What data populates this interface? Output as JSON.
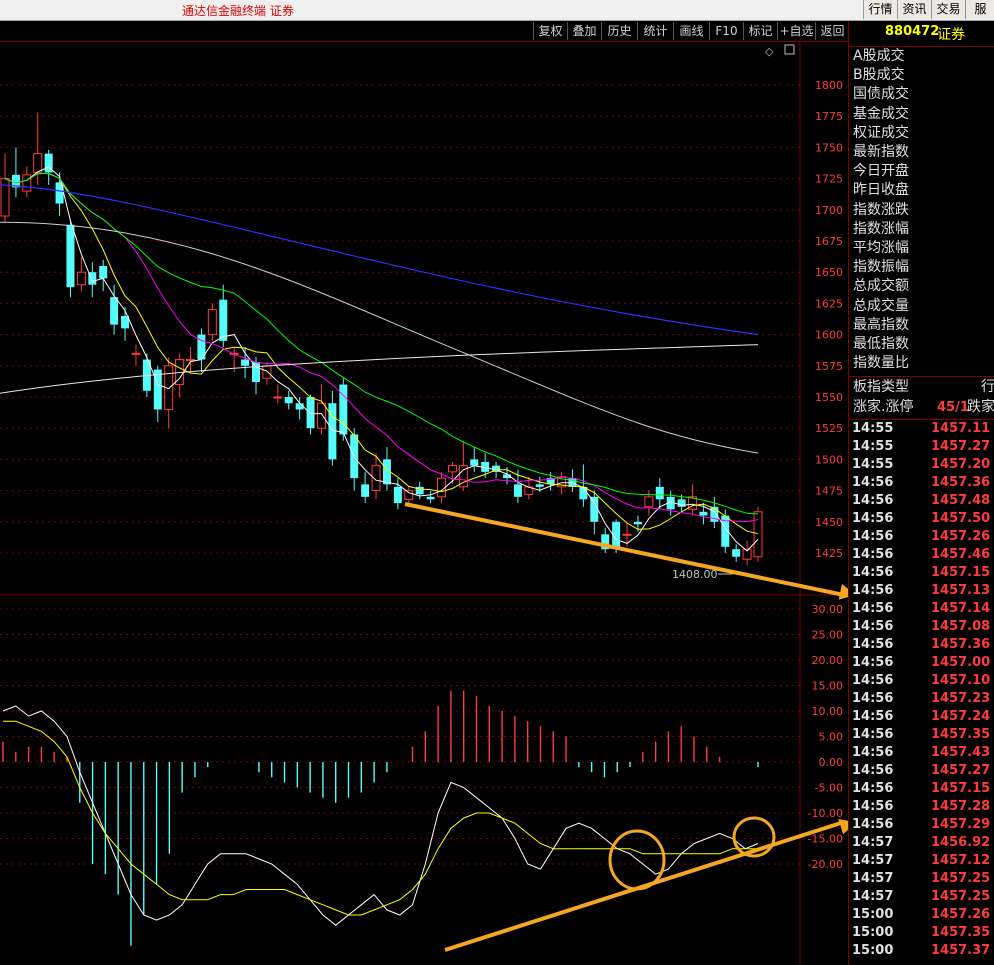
{
  "app": {
    "title": "通达信金融终端  证券"
  },
  "top_buttons": [
    "行情",
    "资讯",
    "交易",
    "服"
  ],
  "toolbar": [
    "复权",
    "叠加",
    "历史",
    "统计",
    "画线",
    "F10",
    "标记",
    "+自选",
    "返回"
  ],
  "sidebar": {
    "code": "880472",
    "name": "证券",
    "labels": [
      "A股成交",
      "B股成交",
      "国债成交",
      "基金成交",
      "权证成交",
      "最新指数",
      "今日开盘",
      "昨日收盘",
      "指数涨跌",
      "指数涨幅",
      "平均涨幅",
      "指数振幅",
      "总成交额",
      "总成交量",
      "最高指数",
      "最低指数",
      "指数量比"
    ],
    "board_type_label": "板指类型",
    "board_type_value": "行",
    "up_down_label": "涨家.涨停",
    "up_down_value": "45/1",
    "down_label": "跌家",
    "ticks": [
      {
        "time": "14:55",
        "price": "1457.11"
      },
      {
        "time": "14:55",
        "price": "1457.27"
      },
      {
        "time": "14:55",
        "price": "1457.20"
      },
      {
        "time": "14:56",
        "price": "1457.36"
      },
      {
        "time": "14:56",
        "price": "1457.48"
      },
      {
        "time": "14:56",
        "price": "1457.50"
      },
      {
        "time": "14:56",
        "price": "1457.26"
      },
      {
        "time": "14:56",
        "price": "1457.46"
      },
      {
        "time": "14:56",
        "price": "1457.15"
      },
      {
        "time": "14:56",
        "price": "1457.13"
      },
      {
        "time": "14:56",
        "price": "1457.14"
      },
      {
        "time": "14:56",
        "price": "1457.08"
      },
      {
        "time": "14:56",
        "price": "1457.36"
      },
      {
        "time": "14:56",
        "price": "1457.00"
      },
      {
        "time": "14:56",
        "price": "1457.10"
      },
      {
        "time": "14:56",
        "price": "1457.23"
      },
      {
        "time": "14:56",
        "price": "1457.24"
      },
      {
        "time": "14:56",
        "price": "1457.35"
      },
      {
        "time": "14:56",
        "price": "1457.43"
      },
      {
        "time": "14:56",
        "price": "1457.27"
      },
      {
        "time": "14:56",
        "price": "1457.15"
      },
      {
        "time": "14:56",
        "price": "1457.28"
      },
      {
        "time": "14:56",
        "price": "1457.29"
      },
      {
        "time": "14:57",
        "price": "1456.92"
      },
      {
        "time": "14:57",
        "price": "1457.12"
      },
      {
        "time": "14:57",
        "price": "1457.25"
      },
      {
        "time": "14:57",
        "price": "1457.25"
      },
      {
        "time": "15:00",
        "price": "1457.26"
      },
      {
        "time": "15:00",
        "price": "1457.35"
      },
      {
        "time": "15:00",
        "price": "1457.37"
      }
    ]
  },
  "chart_data": [
    {
      "type": "candlestick",
      "y_ticks": [
        "1800",
        "1775",
        "1750",
        "1725",
        "1700",
        "1675",
        "1650",
        "1625",
        "1600",
        "1575",
        "1550",
        "1525",
        "1500",
        "1475",
        "1450",
        "1425",
        "1400"
      ],
      "ylim": [
        1400,
        1815
      ],
      "annotation": "1408.00",
      "candles": [
        [
          1695,
          1725,
          1690,
          1745
        ],
        [
          1728,
          1718,
          1710,
          1750
        ],
        [
          1715,
          1728,
          1710,
          1735
        ],
        [
          1730,
          1745,
          1720,
          1778
        ],
        [
          1745,
          1730,
          1720,
          1748
        ],
        [
          1722,
          1705,
          1695,
          1730
        ],
        [
          1688,
          1638,
          1630,
          1692
        ],
        [
          1640,
          1650,
          1635,
          1662
        ],
        [
          1650,
          1640,
          1630,
          1658
        ],
        [
          1655,
          1645,
          1635,
          1660
        ],
        [
          1630,
          1608,
          1600,
          1640
        ],
        [
          1615,
          1605,
          1595,
          1622
        ],
        [
          1585,
          1585,
          1575,
          1592
        ],
        [
          1580,
          1555,
          1550,
          1585
        ],
        [
          1572,
          1540,
          1530,
          1575
        ],
        [
          1540,
          1575,
          1525,
          1582
        ],
        [
          1560,
          1580,
          1550,
          1585
        ],
        [
          1580,
          1580,
          1570,
          1590
        ],
        [
          1600,
          1580,
          1570,
          1605
        ],
        [
          1600,
          1620,
          1595,
          1625
        ],
        [
          1628,
          1595,
          1590,
          1640
        ],
        [
          1585,
          1585,
          1570,
          1590
        ],
        [
          1580,
          1575,
          1565,
          1590
        ],
        [
          1578,
          1562,
          1552,
          1582
        ],
        [
          1565,
          1575,
          1560,
          1578
        ],
        [
          1550,
          1550,
          1545,
          1560
        ],
        [
          1550,
          1545,
          1540,
          1555
        ],
        [
          1545,
          1540,
          1532,
          1550
        ],
        [
          1550,
          1525,
          1520,
          1552
        ],
        [
          1525,
          1545,
          1520,
          1560
        ],
        [
          1545,
          1500,
          1495,
          1555
        ],
        [
          1560,
          1520,
          1515,
          1565
        ],
        [
          1520,
          1485,
          1475,
          1525
        ],
        [
          1480,
          1470,
          1465,
          1490
        ],
        [
          1475,
          1495,
          1468,
          1505
        ],
        [
          1500,
          1480,
          1475,
          1510
        ],
        [
          1478,
          1465,
          1460,
          1485
        ],
        [
          1468,
          1475,
          1462,
          1478
        ],
        [
          1478,
          1472,
          1468,
          1482
        ],
        [
          1470,
          1468,
          1465,
          1475
        ],
        [
          1470,
          1485,
          1465,
          1490
        ],
        [
          1490,
          1495,
          1480,
          1498
        ],
        [
          1478,
          1495,
          1475,
          1515
        ],
        [
          1500,
          1495,
          1490,
          1510
        ],
        [
          1498,
          1490,
          1485,
          1505
        ],
        [
          1495,
          1490,
          1485,
          1498
        ],
        [
          1488,
          1485,
          1480,
          1494
        ],
        [
          1480,
          1470,
          1465,
          1492
        ],
        [
          1472,
          1478,
          1468,
          1486
        ],
        [
          1480,
          1478,
          1474,
          1486
        ],
        [
          1485,
          1480,
          1475,
          1490
        ],
        [
          1478,
          1486,
          1472,
          1490
        ],
        [
          1485,
          1478,
          1474,
          1492
        ],
        [
          1478,
          1468,
          1462,
          1496
        ],
        [
          1470,
          1450,
          1440,
          1475
        ],
        [
          1440,
          1428,
          1425,
          1445
        ],
        [
          1450,
          1430,
          1425,
          1452
        ],
        [
          1440,
          1440,
          1430,
          1450
        ],
        [
          1450,
          1448,
          1442,
          1455
        ],
        [
          1462,
          1470,
          1455,
          1475
        ],
        [
          1478,
          1468,
          1460,
          1485
        ],
        [
          1470,
          1460,
          1455,
          1475
        ],
        [
          1468,
          1462,
          1458,
          1472
        ],
        [
          1460,
          1470,
          1455,
          1480
        ],
        [
          1458,
          1455,
          1448,
          1465
        ],
        [
          1462,
          1450,
          1445,
          1470
        ],
        [
          1455,
          1430,
          1425,
          1460
        ],
        [
          1428,
          1422,
          1418,
          1432
        ],
        [
          1420,
          1428,
          1415,
          1435
        ],
        [
          1422,
          1458,
          1418,
          1462
        ]
      ]
    },
    {
      "type": "bar",
      "y_ticks": [
        "30.00",
        "25.00",
        "20.00",
        "15.00",
        "10.00",
        "5.00",
        "0.00",
        "-5.00",
        "-10.00",
        "-15.00",
        "-20.00"
      ],
      "ylim": [
        -37,
        33
      ],
      "values": [
        4,
        2,
        3,
        3,
        2,
        1,
        -8,
        -20,
        -22,
        -26,
        -36,
        -30,
        -24,
        -18,
        -6,
        -3,
        -1,
        0,
        0,
        0,
        -2,
        -3,
        -4,
        -5,
        -6,
        -7,
        -8,
        -7,
        -6,
        -4,
        -2,
        0,
        3,
        6,
        11,
        14,
        14,
        13,
        11,
        10,
        9,
        8,
        7,
        6,
        5,
        -1,
        -2,
        -3,
        -2,
        -1,
        2,
        4,
        6,
        7,
        5,
        3,
        1,
        0,
        0,
        -1
      ],
      "line1": [
        10,
        11,
        9,
        10,
        8,
        5,
        -2,
        -8,
        -14,
        -20,
        -26,
        -30,
        -31,
        -30,
        -28,
        -24,
        -20,
        -18,
        -18,
        -18,
        -19,
        -20,
        -22,
        -24,
        -27,
        -30,
        -32,
        -30,
        -28,
        -26,
        -29,
        -30,
        -28,
        -20,
        -10,
        -4,
        -5,
        -7,
        -9,
        -11,
        -15,
        -20,
        -21,
        -17,
        -13,
        -12,
        -13,
        -15,
        -17,
        -18,
        -20,
        -22,
        -21,
        -18,
        -16,
        -15,
        -14,
        -15,
        -17,
        -16
      ],
      "line2": [
        8,
        8,
        7,
        6,
        4,
        1,
        -5,
        -10,
        -14,
        -17,
        -20,
        -22,
        -24,
        -26,
        -27,
        -27,
        -27,
        -26,
        -26,
        -25,
        -25,
        -25,
        -25,
        -26,
        -27,
        -28,
        -29,
        -30,
        -30,
        -29,
        -28,
        -27,
        -25,
        -22,
        -17,
        -13,
        -11,
        -10,
        -10,
        -11,
        -12,
        -14,
        -16,
        -17,
        -17,
        -17,
        -17,
        -17,
        -17,
        -17,
        -18,
        -18,
        -18,
        -18,
        -18,
        -18,
        -18,
        -17,
        -17,
        -17
      ]
    }
  ]
}
